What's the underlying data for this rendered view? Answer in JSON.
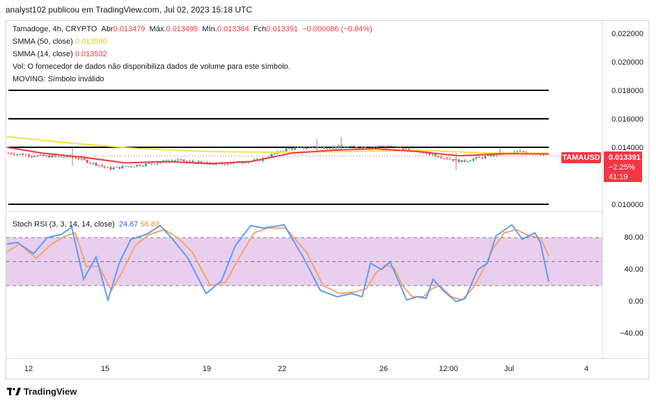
{
  "header": {
    "publisher_text": "analyst102 publicou em TradingView.com, Jul 02, 2023 15:18 UTC"
  },
  "legend": {
    "symbol_line": "Tamadoge, 4h, CRYPTO",
    "open_label": "Abr",
    "open_value": "0.013479",
    "high_label": "Máx.",
    "high_value": "0.013495",
    "low_label": "Mín.",
    "low_value": "0.013364",
    "close_label": "Fch",
    "close_value": "0.013391",
    "change_value": "−0.000086 (−0.64%)",
    "smma50_label": "SMMA (50, close)",
    "smma50_value": "0.013590",
    "smma14_label": "SMMA (14, close)",
    "smma14_value": "0.013532",
    "vol_text": "Vol: O fornecedor de dados não disponibiliza dados de volume para este símbolo.",
    "moving_text": "MOVING: Símbolo inválido"
  },
  "rsi_legend": {
    "label": "Stoch RSI (3, 3, 14, 14, close)",
    "k_value": "24.67",
    "d_value": "56.83"
  },
  "price_axis": {
    "ticks": [
      "0.022000",
      "0.020000",
      "0.018000",
      "0.016000",
      "0.014000",
      "0.010000"
    ]
  },
  "rsi_axis": {
    "ticks": [
      "80.00",
      "40.00",
      "0.00",
      "−40.00"
    ]
  },
  "time_axis": {
    "ticks": [
      "12",
      "15",
      "19",
      "22",
      "26",
      "12:00",
      "Jul",
      "4"
    ]
  },
  "price_tag": {
    "symbol": "TAMAUSD",
    "price": "0.013391",
    "change": "−2.25%",
    "countdown": "41:19"
  },
  "footer": {
    "brand": "TradingView"
  },
  "colors": {
    "up": "#26a69a",
    "down": "#ef5350",
    "smma50": "#f5e33b",
    "smma14": "#f23645",
    "stoch_k": "#5b9cf6",
    "stoch_d": "#f7a26b",
    "band_fill": "#e1bee7"
  },
  "chart_data": [
    {
      "type": "candlestick",
      "title": "Tamadoge, 4h, CRYPTO",
      "ylim": [
        0.0095,
        0.0225
      ],
      "horizontal_levels": [
        0.018,
        0.016,
        0.014,
        0.01
      ],
      "series": [
        {
          "name": "SMMA (50, close)",
          "last": 0.01359
        },
        {
          "name": "SMMA (14, close)",
          "last": 0.013532
        }
      ],
      "close_path": [
        [
          0,
          0.0136
        ],
        [
          40,
          0.0134
        ],
        [
          95,
          0.0133
        ],
        [
          145,
          0.0125
        ],
        [
          195,
          0.0128
        ],
        [
          240,
          0.0131
        ],
        [
          300,
          0.0128
        ],
        [
          360,
          0.0131
        ],
        [
          400,
          0.0139
        ],
        [
          440,
          0.014
        ],
        [
          500,
          0.014
        ],
        [
          545,
          0.0141
        ],
        [
          600,
          0.0136
        ],
        [
          650,
          0.013
        ],
        [
          700,
          0.0135
        ],
        [
          740,
          0.0137
        ],
        [
          790,
          0.01339
        ]
      ]
    },
    {
      "type": "line",
      "title": "Stoch RSI (3, 3, 14, 14, close)",
      "ylim": [
        -60,
        100
      ],
      "bands": [
        80,
        50,
        20
      ],
      "series": [
        {
          "name": "K",
          "last": 24.67
        },
        {
          "name": "D",
          "last": 56.83
        }
      ]
    }
  ]
}
